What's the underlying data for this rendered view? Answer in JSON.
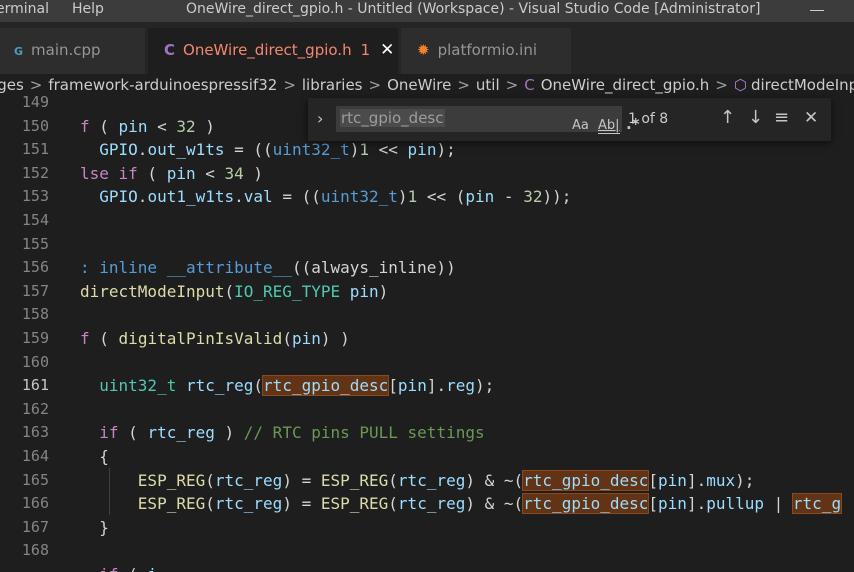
{
  "menu": {
    "terminal": "erminal",
    "help": "Help"
  },
  "window_title": "OneWire_direct_gpio.h - Untitled (Workspace) - Visual Studio Code [Administrator]",
  "tabs": [
    {
      "icon": "cpp-file-icon",
      "icon_text": "G",
      "label": "main.cpp"
    },
    {
      "icon": "c-file-icon",
      "icon_text": "C",
      "label": "OneWire_direct_gpio.h",
      "modified_count": "1",
      "close": "✕"
    },
    {
      "icon": "platformio-icon",
      "icon_text": "✹",
      "label": "platformio.ini"
    }
  ],
  "breadcrumb": {
    "items": [
      "ages",
      "framework-arduinoespressif32",
      "libraries",
      "OneWire",
      "util"
    ],
    "file": "OneWire_direct_gpio.h",
    "symbol": "directModeInput(IO",
    "separator": ">"
  },
  "find": {
    "term": "rtc_gpio_desc",
    "match_case": "Aa",
    "whole_word": "Ab|",
    "regex": ".*",
    "count": "1 of 8"
  },
  "line_numbers": [
    "149",
    "150",
    "151",
    "152",
    "153",
    "154",
    "155",
    "156",
    "157",
    "158",
    "159",
    "160",
    "161",
    "162",
    "163",
    "164",
    "165",
    "166",
    "167",
    "168"
  ],
  "current_line": "161",
  "colors": {
    "accent_modified": "#f48771",
    "find_highlight": "#623315",
    "editor_bg": "#1e1e1e"
  }
}
